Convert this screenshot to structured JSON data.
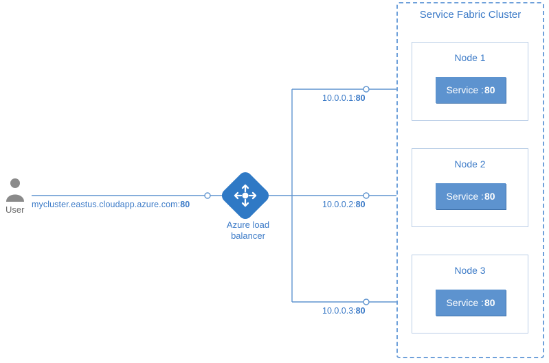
{
  "user": {
    "label": "User"
  },
  "cluster_url": {
    "host": "mycluster.eastus.cloudapp.azure.com:",
    "port": "80"
  },
  "load_balancer": {
    "label": "Azure load balancer"
  },
  "branches": [
    {
      "ip": "10.0.0.1:",
      "port": "80"
    },
    {
      "ip": "10.0.0.2:",
      "port": "80"
    },
    {
      "ip": "10.0.0.3:",
      "port": "80"
    }
  ],
  "cluster": {
    "title": "Service Fabric Cluster",
    "nodes": [
      {
        "title": "Node 1",
        "service": "Service :",
        "port": "80"
      },
      {
        "title": "Node 2",
        "service": "Service :",
        "port": "80"
      },
      {
        "title": "Node 3",
        "service": "Service :",
        "port": "80"
      }
    ]
  }
}
